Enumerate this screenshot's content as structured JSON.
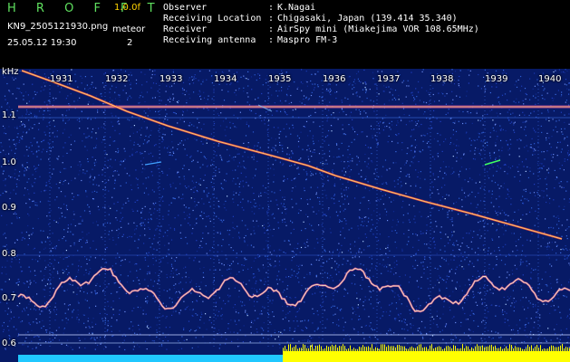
{
  "header": {
    "title": "H R O F F T",
    "version": "1.0.0f",
    "filename": "KN9_2505121930.png",
    "meteor_label": "meteor",
    "timestamp": "25.05.12  19:30",
    "meteor_count": "2",
    "info": [
      {
        "key": "Observer",
        "value": "K.Nagai"
      },
      {
        "key": "Receiving Location",
        "value": "Chigasaki, Japan (139.414 35.340)"
      },
      {
        "key": "Receiver",
        "value": "AirSpy mini (Miakejima VOR 108.65MHz)"
      },
      {
        "key": "Receiving antenna",
        "value": "Maspro FM-3"
      }
    ]
  },
  "axes": {
    "y_unit": "kHz",
    "y_ticks": [
      "1.1",
      "1.0",
      "0.9",
      "0.8",
      "0.7",
      "0.6"
    ],
    "x_ticks": [
      "1931",
      "1932",
      "1933",
      "1934",
      "1935",
      "1936",
      "1937",
      "1938",
      "1939",
      "1940"
    ]
  },
  "colors": {
    "background": "#000000",
    "spectrogram_bg": "#071a66",
    "title": "#5fe05f",
    "version": "#ffd400",
    "signal": "#ffffff",
    "bottom_band_left": "#20c8ff",
    "bottom_band_right": "#ffff00"
  }
}
